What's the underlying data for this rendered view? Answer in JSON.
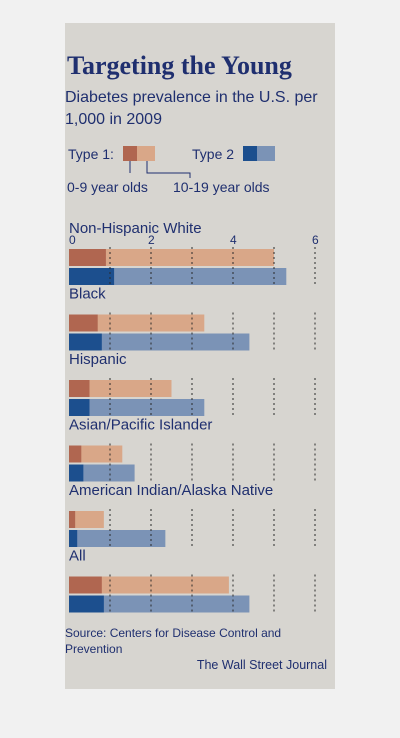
{
  "colors": {
    "type1_0_9": "#b06650",
    "type1_10_19": "#d9a788",
    "type2_0_9": "#1c4f8e",
    "type2_10_19": "#7b93b6",
    "text": "#1f2f6f"
  },
  "header": {
    "title": "Targeting the Young",
    "subtitle": "Diabetes prevalence in the U.S. per 1,000 in 2009"
  },
  "legend": {
    "type1_label": "Type 1:",
    "type2_label": "Type 2",
    "age_young": "0-9 year olds",
    "age_old": "10-19 year olds"
  },
  "footer": {
    "source": "Source: Centers for Disease Control and Prevention",
    "credit": "The Wall Street Journal"
  },
  "chart_data": {
    "type": "bar",
    "orientation": "horizontal",
    "xlim": [
      0,
      6
    ],
    "xticks": [
      "0",
      "2",
      "4",
      "6"
    ],
    "grid": true,
    "categories": [
      "Non-Hispanic White",
      "Black",
      "Hispanic",
      "Asian/Pacific Islander",
      "American Indian/Alaska Native",
      "All"
    ],
    "series": [
      {
        "name": "Type 1, 0-9 year olds",
        "values": [
          0.9,
          0.7,
          0.5,
          0.3,
          0.15,
          0.8
        ]
      },
      {
        "name": "Type 1, 10-19 year olds",
        "values": [
          5.0,
          3.3,
          2.5,
          1.3,
          0.85,
          3.9
        ]
      },
      {
        "name": "Type 2, 0-9 year olds",
        "values": [
          1.1,
          0.8,
          0.5,
          0.35,
          0.2,
          0.85
        ]
      },
      {
        "name": "Type 2, 10-19 year olds",
        "values": [
          5.3,
          4.4,
          3.3,
          1.6,
          2.35,
          4.4
        ]
      }
    ]
  }
}
